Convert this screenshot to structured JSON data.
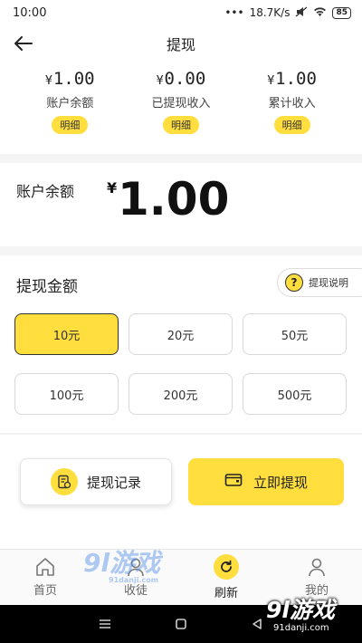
{
  "status_bar": {
    "time": "10:00",
    "network_speed": "18.7K/s",
    "battery": "85"
  },
  "header": {
    "title": "提现"
  },
  "stats": [
    {
      "currency": "¥",
      "value": "1.00",
      "label": "账户余额",
      "detail_label": "明细"
    },
    {
      "currency": "¥",
      "value": "0.00",
      "label": "已提现收入",
      "detail_label": "明细"
    },
    {
      "currency": "¥",
      "value": "1.00",
      "label": "累计收入",
      "detail_label": "明细"
    }
  ],
  "balance": {
    "label": "账户余额",
    "currency": "¥",
    "amount": "1.00"
  },
  "withdraw_amount": {
    "title": "提现金额",
    "help_label": "提现说明",
    "help_icon": "?",
    "options": [
      "10元",
      "20元",
      "50元",
      "100元",
      "200元",
      "500元"
    ],
    "selected_index": 0
  },
  "actions": {
    "record_label": "提现记录",
    "withdraw_label": "立即提现"
  },
  "tabs": [
    {
      "label": "首页",
      "icon": "home-icon"
    },
    {
      "label": "收徒",
      "icon": "apprentice-icon"
    },
    {
      "label": "刷新",
      "icon": "refresh-icon"
    },
    {
      "label": "我的",
      "icon": "user-icon"
    }
  ],
  "watermarks": {
    "mid_logo": "9l游戏",
    "mid_url": "91danji.com",
    "corner_logo": "9l游戏",
    "corner_url": "91danji.com"
  },
  "colors": {
    "accent": "#ffde3d",
    "text": "#222222",
    "border": "#d9d9d9"
  }
}
